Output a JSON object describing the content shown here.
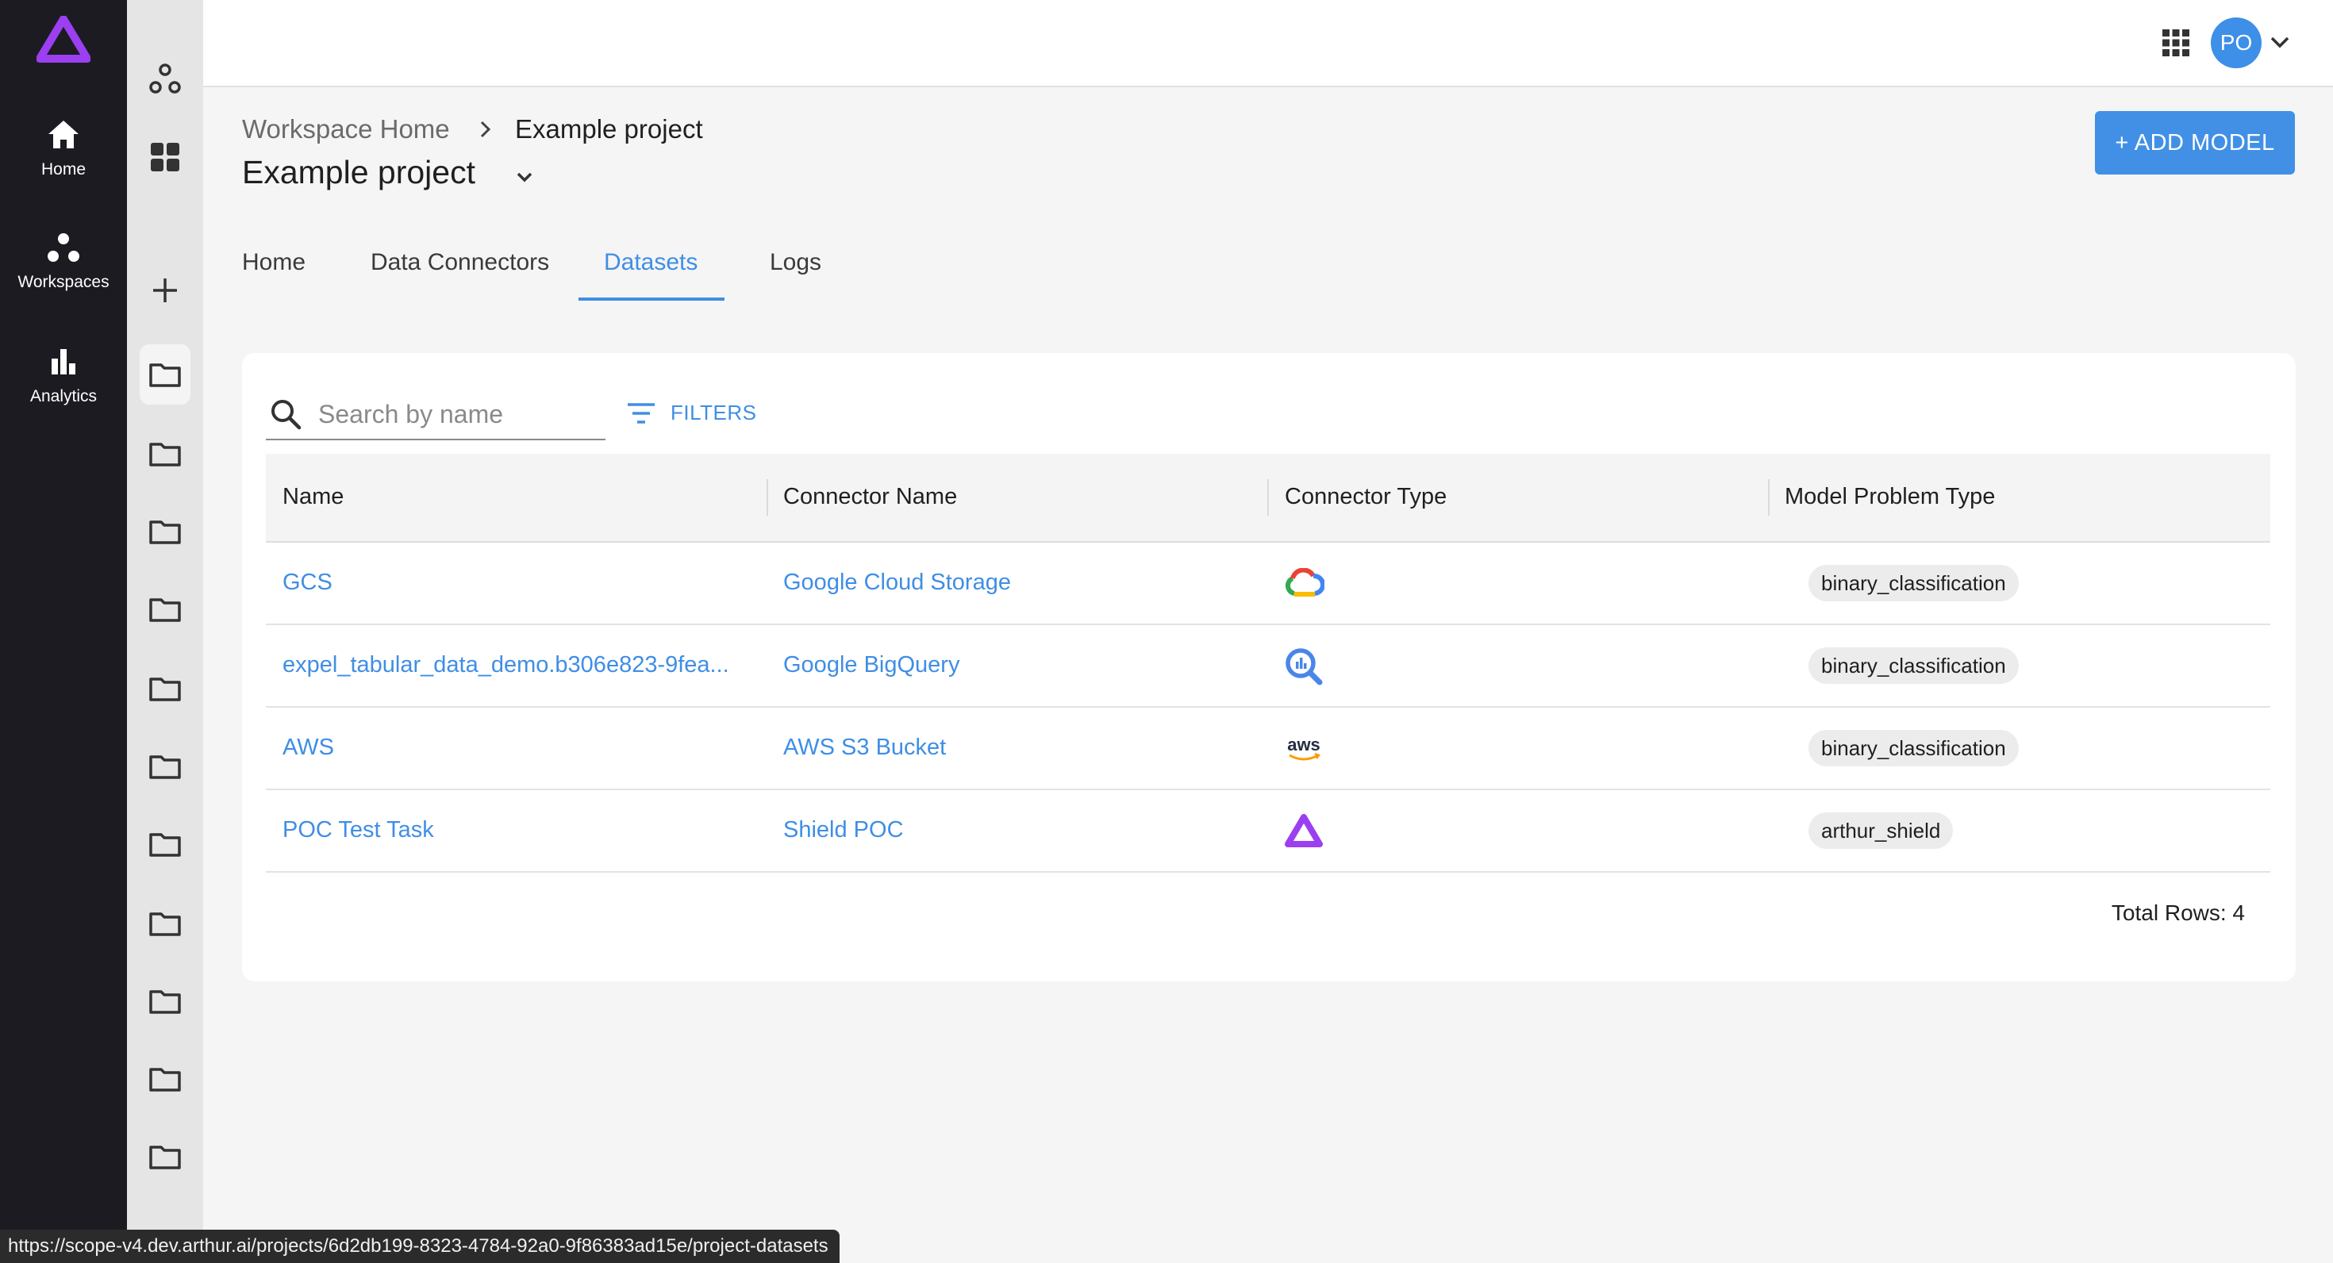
{
  "rail": {
    "items": [
      {
        "label": "Home",
        "icon": "home-icon"
      },
      {
        "label": "Workspaces",
        "icon": "workspaces-icon"
      },
      {
        "label": "Analytics",
        "icon": "analytics-icon"
      }
    ]
  },
  "topbar": {
    "avatar_initials": "PO"
  },
  "breadcrumb": {
    "home": "Workspace Home",
    "current": "Example project"
  },
  "page": {
    "title": "Example project",
    "add_button": "+ ADD MODEL"
  },
  "tabs": [
    {
      "label": "Home",
      "active": false
    },
    {
      "label": "Data Connectors",
      "active": false
    },
    {
      "label": "Datasets",
      "active": true
    },
    {
      "label": "Logs",
      "active": false
    }
  ],
  "search": {
    "placeholder": "Search by name",
    "value": ""
  },
  "filters_label": "FILTERS",
  "table": {
    "columns": [
      "Name",
      "Connector Name",
      "Connector Type",
      "Model Problem Type"
    ],
    "rows": [
      {
        "name": "GCS",
        "connector_name": "Google Cloud Storage",
        "connector_type": "google-cloud-icon",
        "problem_type": "binary_classification"
      },
      {
        "name": "expel_tabular_data_demo.b306e823-9fea...",
        "connector_name": "Google BigQuery",
        "connector_type": "bigquery-icon",
        "problem_type": "binary_classification"
      },
      {
        "name": "AWS",
        "connector_name": "AWS S3 Bucket",
        "connector_type": "aws-icon",
        "problem_type": "binary_classification"
      },
      {
        "name": "POC Test Task",
        "connector_name": "Shield POC",
        "connector_type": "arthur-shield-icon",
        "problem_type": "arthur_shield"
      }
    ],
    "total": "Total Rows: 4"
  },
  "aws_logo_text": "aws",
  "status_url": "https://scope-v4.dev.arthur.ai/projects/6d2db199-8323-4784-92a0-9f86383ad15e/project-datasets",
  "colors": {
    "accent": "#3f8ee4",
    "rail": "#1c1b22",
    "brand_purple": "#9b3ff0"
  }
}
